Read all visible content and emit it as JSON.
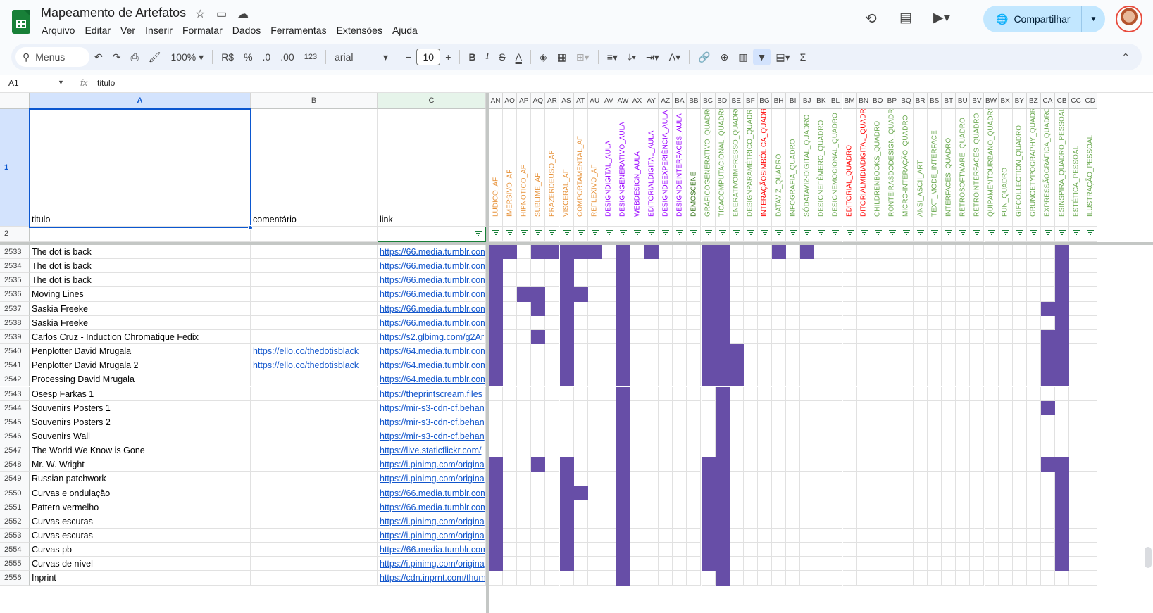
{
  "app": {
    "title": "Mapeamento de Artefatos",
    "star_icon": "star-icon",
    "folder_icon": "move-folder-icon",
    "cloud_icon": "cloud-status-icon"
  },
  "menu": [
    "Arquivo",
    "Editar",
    "Ver",
    "Inserir",
    "Formatar",
    "Dados",
    "Ferramentas",
    "Extensões",
    "Ajuda"
  ],
  "header_right": {
    "share_label": "Compartilhar"
  },
  "toolbar": {
    "menus_label": "Menus",
    "zoom": "100%",
    "currency": "R$",
    "percent": "%",
    "dec_less": ".0",
    "dec_more": ".00",
    "format_123": "123",
    "font": "arial",
    "font_size": "10",
    "bold": "B",
    "italic": "I",
    "strike": "S",
    "text_color": "A",
    "sum": "Σ"
  },
  "formula_bar": {
    "cell_ref": "A1",
    "fx": "fx",
    "value": "titulo"
  },
  "colors": {
    "filled_cell": "#674ea7",
    "orange_text": "#e69138",
    "purple_text": "#9900ff",
    "green_text": "#6aa84f",
    "red_text": "#ff0000",
    "dark_green_text": "#38761d",
    "selection": "#0b57d0"
  },
  "sheet": {
    "left_columns": [
      "A",
      "B",
      "C"
    ],
    "header_row": {
      "row_num": "1",
      "filter_row_num": "2",
      "A": "titulo",
      "B": "comentário",
      "C": "link"
    },
    "rows": [
      {
        "n": "2533",
        "a": "The dot is back",
        "b": "",
        "c": "https://66.media.tumblr.com"
      },
      {
        "n": "2534",
        "a": "The dot is back",
        "b": "",
        "c": "https://66.media.tumblr.com"
      },
      {
        "n": "2535",
        "a": "The dot is back",
        "b": "",
        "c": "https://66.media.tumblr.com"
      },
      {
        "n": "2536",
        "a": "Moving Lines",
        "b": "",
        "c": "https://66.media.tumblr.com"
      },
      {
        "n": "2537",
        "a": "Saskia Freeke",
        "b": "",
        "c": "https://66.media.tumblr.com"
      },
      {
        "n": "2538",
        "a": "Saskia Freeke",
        "b": "",
        "c": "https://66.media.tumblr.com"
      },
      {
        "n": "2539",
        "a": "Carlos Cruz - Induction Chromatique Fedix",
        "b": "",
        "c": "https://s2.glbimg.com/g2Ar"
      },
      {
        "n": "2540",
        "a": "Penplotter David Mrugala",
        "b": "https://ello.co/thedotisblack",
        "c": "https://64.media.tumblr.com"
      },
      {
        "n": "2541",
        "a": "Penplotter David Mrugala 2",
        "b": "https://ello.co/thedotisblack",
        "c": "https://64.media.tumblr.com"
      },
      {
        "n": "2542",
        "a": "Processing David Mrugala",
        "b": "",
        "c": "https://64.media.tumblr.com"
      },
      {
        "n": "2543",
        "a": "Osesp Farkas 1",
        "b": "",
        "c": "https://theprintscream.files"
      },
      {
        "n": "2544",
        "a": "Souvenirs Posters 1",
        "b": "",
        "c": "https://mir-s3-cdn-cf.behan"
      },
      {
        "n": "2545",
        "a": "Souvenirs Posters 2",
        "b": "",
        "c": "https://mir-s3-cdn-cf.behan"
      },
      {
        "n": "2546",
        "a": "Souvenirs Wall",
        "b": "",
        "c": "https://mir-s3-cdn-cf.behan"
      },
      {
        "n": "2547",
        "a": "The World We Know is Gone",
        "b": "",
        "c": "https://live.staticflickr.com/"
      },
      {
        "n": "2548",
        "a": "Mr. W. Wright",
        "b": "",
        "c": "https://i.pinimg.com/origina"
      },
      {
        "n": "2549",
        "a": "Russian patchwork",
        "b": "",
        "c": "https://i.pinimg.com/origina"
      },
      {
        "n": "2550",
        "a": "Curvas e ondulação",
        "b": "",
        "c": "https://66.media.tumblr.com"
      },
      {
        "n": "2551",
        "a": "Pattern vermelho",
        "b": "",
        "c": "https://66.media.tumblr.com"
      },
      {
        "n": "2552",
        "a": "Curvas escuras",
        "b": "",
        "c": "https://i.pinimg.com/origina"
      },
      {
        "n": "2553",
        "a": "Curvas escuras",
        "b": "",
        "c": "https://i.pinimg.com/origina"
      },
      {
        "n": "2554",
        "a": "Curvas pb",
        "b": "",
        "c": "https://66.media.tumblr.com"
      },
      {
        "n": "2555",
        "a": "Curvas de nível",
        "b": "",
        "c": "https://i.pinimg.com/origina"
      },
      {
        "n": "2556",
        "a": "Inprint",
        "b": "",
        "c": "https://cdn.inprnt.com/thum"
      }
    ],
    "right_columns": [
      {
        "col": "AN",
        "hdr": "LUDICO_AF",
        "color": "orange"
      },
      {
        "col": "AO",
        "hdr": "IMERSIVO_AF",
        "color": "orange"
      },
      {
        "col": "AP",
        "hdr": "HIPNOTICO_AF",
        "color": "orange"
      },
      {
        "col": "AQ",
        "hdr": "SUBLIME_AF",
        "color": "orange"
      },
      {
        "col": "AR",
        "hdr": "PRAZERDEUSO_AF",
        "color": "orange"
      },
      {
        "col": "AS",
        "hdr": "VISCERAL_AF",
        "color": "orange"
      },
      {
        "col": "AT",
        "hdr": "COMPORTAMENTAL_AF",
        "color": "orange"
      },
      {
        "col": "AU",
        "hdr": "REFLEXIVO_AF",
        "color": "orange"
      },
      {
        "col": "AV",
        "hdr": "DESIGNDIGITAL_AULA",
        "color": "purple"
      },
      {
        "col": "AW",
        "hdr": "DESIGNGENERATIVO_AULA",
        "color": "purple"
      },
      {
        "col": "AX",
        "hdr": "WEBDESIGN_AULA",
        "color": "purple"
      },
      {
        "col": "AY",
        "hdr": "EDITORIALDIGITAL_AULA",
        "color": "purple"
      },
      {
        "col": "AZ",
        "hdr": "DESIGNDEEXPERIÊNCIA_AULA",
        "color": "purple"
      },
      {
        "col": "BA",
        "hdr": "DESIGNDEINTERFACES_AULA",
        "color": "purple"
      },
      {
        "col": "BB",
        "hdr": "DEMOSCENE",
        "color": "darkgreen"
      },
      {
        "col": "BC",
        "hdr": "GRÁFICOGENERATIVO_QUADRO",
        "color": "green"
      },
      {
        "col": "BD",
        "hdr": "TICACOMPUTACIONAL_QUADRO",
        "color": "green"
      },
      {
        "col": "BE",
        "hdr": "ENERATIVOIMPRESSO_QUADRO",
        "color": "green"
      },
      {
        "col": "BF",
        "hdr": "DESIGNPARAMÉTRICO_QUADRO",
        "color": "green"
      },
      {
        "col": "BG",
        "hdr": "INTERAÇÃOSIMBÓLICA_QUADRO",
        "color": "red"
      },
      {
        "col": "BH",
        "hdr": "DATAVIZ_QUADRO",
        "color": "green"
      },
      {
        "col": "BI",
        "hdr": "INFOGRAFIA_QUADRO",
        "color": "green"
      },
      {
        "col": "BJ",
        "hdr": "SÓDATAVIZ-DIGITAL_QUADRO",
        "color": "green"
      },
      {
        "col": "BK",
        "hdr": "DESIGNEFÊMERO_QUADRO",
        "color": "green"
      },
      {
        "col": "BL",
        "hdr": "DESIGNEMOCIONAL_QUADRO",
        "color": "green"
      },
      {
        "col": "BM",
        "hdr": "EDITORIAL_QUADRO",
        "color": "red"
      },
      {
        "col": "BN",
        "hdr": "DITORIALMIDIADIGITAL_QUADRO",
        "color": "red"
      },
      {
        "col": "BO",
        "hdr": "CHILDRENBOOKS_QUADRO",
        "color": "green"
      },
      {
        "col": "BP",
        "hdr": "RONTEIRASDODESIGN_QUADRO",
        "color": "green"
      },
      {
        "col": "BQ",
        "hdr": "MICRO-INTERAÇÃO_QUADRO",
        "color": "green"
      },
      {
        "col": "BR",
        "hdr": "ANSI_ASCII_ART",
        "color": "green"
      },
      {
        "col": "BS",
        "hdr": "TEXT_MODE_INTERFACE",
        "color": "green"
      },
      {
        "col": "BT",
        "hdr": "INTERFACES_QUADRO",
        "color": "green"
      },
      {
        "col": "BU",
        "hdr": "RETROSOFTWARE_QUADRO",
        "color": "green"
      },
      {
        "col": "BV",
        "hdr": "RETROINTERFACES_QUADRO",
        "color": "green"
      },
      {
        "col": "BW",
        "hdr": "QUIPAMENTOURBANO_QUADRO",
        "color": "green"
      },
      {
        "col": "BX",
        "hdr": "FUN_QUADRO",
        "color": "green"
      },
      {
        "col": "BY",
        "hdr": "GIFCOLLECTION_QUADRO",
        "color": "green"
      },
      {
        "col": "BZ",
        "hdr": "GRUNGETYPOGRAPHY_QUADRO",
        "color": "green"
      },
      {
        "col": "CA",
        "hdr": "EXPRESSÃOGRÁFICA_QUADRO",
        "color": "green"
      },
      {
        "col": "CB",
        "hdr": "ESINSPIRA_QUADRO_PESSOAL",
        "color": "green"
      },
      {
        "col": "CC",
        "hdr": "ESTÉTICA_PESSOAL",
        "color": "green"
      },
      {
        "col": "CD",
        "hdr": "ILUSTRAÇÃO_PESSOAL",
        "color": "green"
      }
    ],
    "filled": [
      [
        "AN",
        "AO",
        "AQ",
        "AR",
        "AS",
        "AT",
        "AU",
        "AW",
        "AY",
        "BC",
        "BD",
        "BH",
        "BJ",
        "CB"
      ],
      [
        "AN",
        "AS",
        "AW",
        "BC",
        "BD",
        "CB"
      ],
      [
        "AN",
        "AS",
        "AW",
        "BC",
        "BD",
        "CB"
      ],
      [
        "AN",
        "AP",
        "AQ",
        "AS",
        "AT",
        "AW",
        "BC",
        "BD",
        "CB"
      ],
      [
        "AN",
        "AQ",
        "AS",
        "AW",
        "BC",
        "BD",
        "CA",
        "CB"
      ],
      [
        "AN",
        "AS",
        "AW",
        "BC",
        "BD",
        "CB"
      ],
      [
        "AN",
        "AQ",
        "AS",
        "AW",
        "BC",
        "BD",
        "CA",
        "CB"
      ],
      [
        "AN",
        "AS",
        "AW",
        "BC",
        "BD",
        "BE",
        "CA",
        "CB"
      ],
      [
        "AN",
        "AS",
        "AW",
        "BC",
        "BD",
        "BE",
        "CA",
        "CB"
      ],
      [
        "AN",
        "AS",
        "AW",
        "BC",
        "BD",
        "BE",
        "CA",
        "CB"
      ],
      [
        "AW",
        "BD"
      ],
      [
        "AW",
        "BD",
        "CA"
      ],
      [
        "AW",
        "BD"
      ],
      [
        "AW",
        "BD"
      ],
      [
        "AW",
        "BD"
      ],
      [
        "AN",
        "AQ",
        "AS",
        "AW",
        "BC",
        "BD",
        "CA",
        "CB"
      ],
      [
        "AN",
        "AS",
        "AW",
        "BC",
        "BD",
        "CB"
      ],
      [
        "AN",
        "AS",
        "AT",
        "AW",
        "BC",
        "BD",
        "CB"
      ],
      [
        "AN",
        "AS",
        "AW",
        "BC",
        "BD",
        "CB"
      ],
      [
        "AN",
        "AS",
        "AW",
        "BC",
        "BD",
        "CB"
      ],
      [
        "AN",
        "AS",
        "AW",
        "BC",
        "BD",
        "CB"
      ],
      [
        "AN",
        "AS",
        "AW",
        "BC",
        "BD",
        "CB"
      ],
      [
        "AN",
        "AS",
        "AW",
        "BC",
        "BD",
        "CB"
      ],
      [
        "AW",
        "BD"
      ]
    ]
  }
}
